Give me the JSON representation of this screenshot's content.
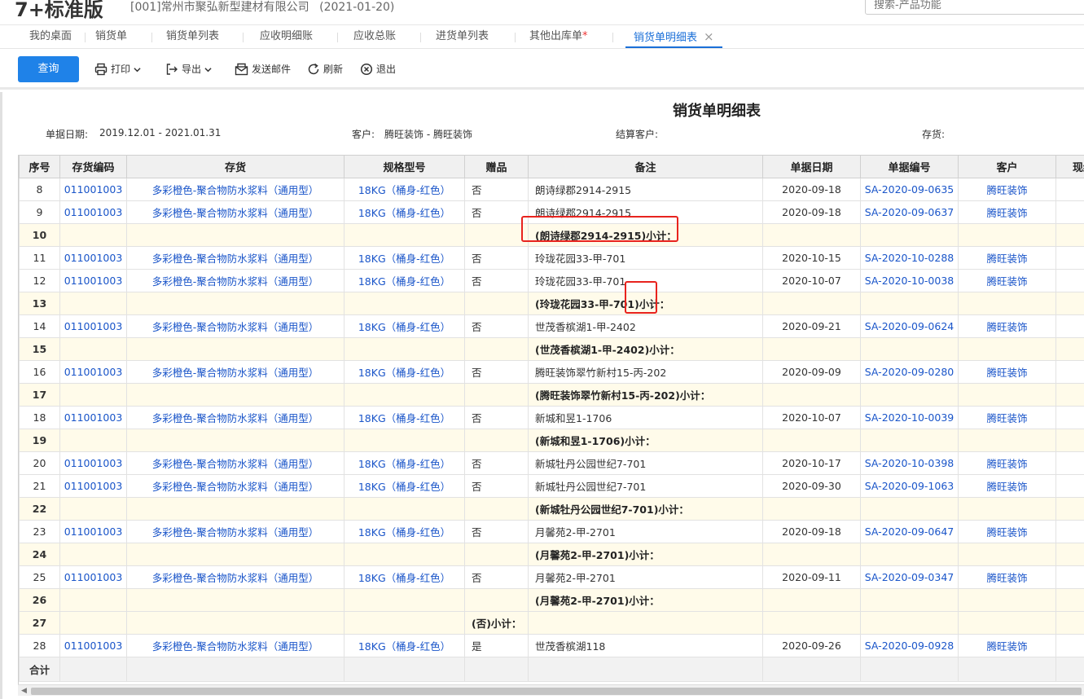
{
  "app": {
    "logo": "7+标准版",
    "company": "[001]常州市聚弘新型建材有限公司",
    "date": "(2021-01-20)",
    "search_placeholder": "搜索-产品功能"
  },
  "tabs": [
    {
      "label": "我的桌面"
    },
    {
      "label": "销货单"
    },
    {
      "label": "销货单列表"
    },
    {
      "label": "应收明细账"
    },
    {
      "label": "应收总账"
    },
    {
      "label": "进货单列表"
    },
    {
      "label": "其他出库单",
      "star": "*"
    },
    {
      "label": "销货单明细表",
      "close": "×"
    }
  ],
  "toolbar": {
    "query": "查询",
    "print": "打印",
    "export": "导出",
    "email": "发送邮件",
    "refresh": "刷新",
    "exit": "退出"
  },
  "report": {
    "title": "销货单明细表",
    "filters": {
      "date_label": "单据日期:",
      "date_value": "2019.12.01 - 2021.01.31",
      "customer_label": "客户:",
      "customer_value": "腾旺装饰 - 腾旺装饰",
      "settle_label": "结算客户:",
      "stock_label": "存货:"
    }
  },
  "table": {
    "columns": [
      "序号",
      "存货编码",
      "存货",
      "规格型号",
      "赠品",
      "备注",
      "单据日期",
      "单据编号",
      "客户",
      "现结"
    ],
    "rows": [
      {
        "idx": "8",
        "code": "011001003",
        "item": "多彩橙色-聚合物防水浆料（通用型）",
        "spec": "18KG（桶身-红色）",
        "gift": "否",
        "note": "朗诗绿郡2914-2915",
        "date": "2020-09-18",
        "no": "SA-2020-09-0635",
        "cust": "腾旺装饰"
      },
      {
        "idx": "9",
        "code": "011001003",
        "item": "多彩橙色-聚合物防水浆料（通用型）",
        "spec": "18KG（桶身-红色）",
        "gift": "否",
        "note": "朗诗绿郡2914-2915",
        "date": "2020-09-18",
        "no": "SA-2020-09-0637",
        "cust": "腾旺装饰"
      },
      {
        "idx": "10",
        "sub": true,
        "note": "(朗诗绿郡2914-2915)小计："
      },
      {
        "idx": "11",
        "code": "011001003",
        "item": "多彩橙色-聚合物防水浆料（通用型）",
        "spec": "18KG（桶身-红色）",
        "gift": "否",
        "note": "玲珑花园33-甲-701",
        "date": "2020-10-15",
        "no": "SA-2020-10-0288",
        "cust": "腾旺装饰"
      },
      {
        "idx": "12",
        "code": "011001003",
        "item": "多彩橙色-聚合物防水浆料（通用型）",
        "spec": "18KG（桶身-红色）",
        "gift": "否",
        "note": "玲珑花园33-甲-701",
        "date": "2020-10-07",
        "no": "SA-2020-10-0038",
        "cust": "腾旺装饰"
      },
      {
        "idx": "13",
        "sub": true,
        "note": "(玲珑花园33-甲-701)小计："
      },
      {
        "idx": "14",
        "code": "011001003",
        "item": "多彩橙色-聚合物防水浆料（通用型）",
        "spec": "18KG（桶身-红色）",
        "gift": "否",
        "note": "世茂香槟湖1-甲-2402",
        "date": "2020-09-21",
        "no": "SA-2020-09-0624",
        "cust": "腾旺装饰"
      },
      {
        "idx": "15",
        "sub": true,
        "note": "(世茂香槟湖1-甲-2402)小计："
      },
      {
        "idx": "16",
        "code": "011001003",
        "item": "多彩橙色-聚合物防水浆料（通用型）",
        "spec": "18KG（桶身-红色）",
        "gift": "否",
        "note": "腾旺装饰翠竹新村15-丙-202",
        "date": "2020-09-09",
        "no": "SA-2020-09-0280",
        "cust": "腾旺装饰"
      },
      {
        "idx": "17",
        "sub": true,
        "note": "(腾旺装饰翠竹新村15-丙-202)小计："
      },
      {
        "idx": "18",
        "code": "011001003",
        "item": "多彩橙色-聚合物防水浆料（通用型）",
        "spec": "18KG（桶身-红色）",
        "gift": "否",
        "note": "新城和昱1-1706",
        "date": "2020-10-07",
        "no": "SA-2020-10-0039",
        "cust": "腾旺装饰"
      },
      {
        "idx": "19",
        "sub": true,
        "note": "(新城和昱1-1706)小计："
      },
      {
        "idx": "20",
        "code": "011001003",
        "item": "多彩橙色-聚合物防水浆料（通用型）",
        "spec": "18KG（桶身-红色）",
        "gift": "否",
        "note": "新城牡丹公园世纪7-701",
        "date": "2020-10-17",
        "no": "SA-2020-10-0398",
        "cust": "腾旺装饰"
      },
      {
        "idx": "21",
        "code": "011001003",
        "item": "多彩橙色-聚合物防水浆料（通用型）",
        "spec": "18KG（桶身-红色）",
        "gift": "否",
        "note": "新城牡丹公园世纪7-701",
        "date": "2020-09-30",
        "no": "SA-2020-09-1063",
        "cust": "腾旺装饰"
      },
      {
        "idx": "22",
        "sub": true,
        "note": "(新城牡丹公园世纪7-701)小计："
      },
      {
        "idx": "23",
        "code": "011001003",
        "item": "多彩橙色-聚合物防水浆料（通用型）",
        "spec": "18KG（桶身-红色）",
        "gift": "否",
        "note": "月馨苑2-甲-2701",
        "date": "2020-09-18",
        "no": "SA-2020-09-0647",
        "cust": "腾旺装饰"
      },
      {
        "idx": "24",
        "sub": true,
        "note": "(月馨苑2-甲-2701)小计："
      },
      {
        "idx": "25",
        "code": "011001003",
        "item": "多彩橙色-聚合物防水浆料（通用型）",
        "spec": "18KG（桶身-红色）",
        "gift": "否",
        "note": "月馨苑2-甲-2701",
        "date": "2020-09-11",
        "no": "SA-2020-09-0347",
        "cust": "腾旺装饰"
      },
      {
        "idx": "26",
        "sub": true,
        "note": "(月馨苑2-甲-2701)小计："
      },
      {
        "idx": "27",
        "sub": true,
        "giftsub": "(否)小计："
      },
      {
        "idx": "28",
        "code": "011001003",
        "item": "多彩橙色-聚合物防水浆料（通用型）",
        "spec": "18KG（桶身-红色）",
        "gift": "是",
        "note": "世茂香槟湖118",
        "date": "2020-09-26",
        "no": "SA-2020-09-0928",
        "cust": "腾旺装饰"
      }
    ],
    "total_label": "合计"
  },
  "colors": {
    "accent": "#1f82e8",
    "link": "#1a55c9",
    "subtotal_bg": "#fffbea",
    "highlight": "#e8231e"
  }
}
